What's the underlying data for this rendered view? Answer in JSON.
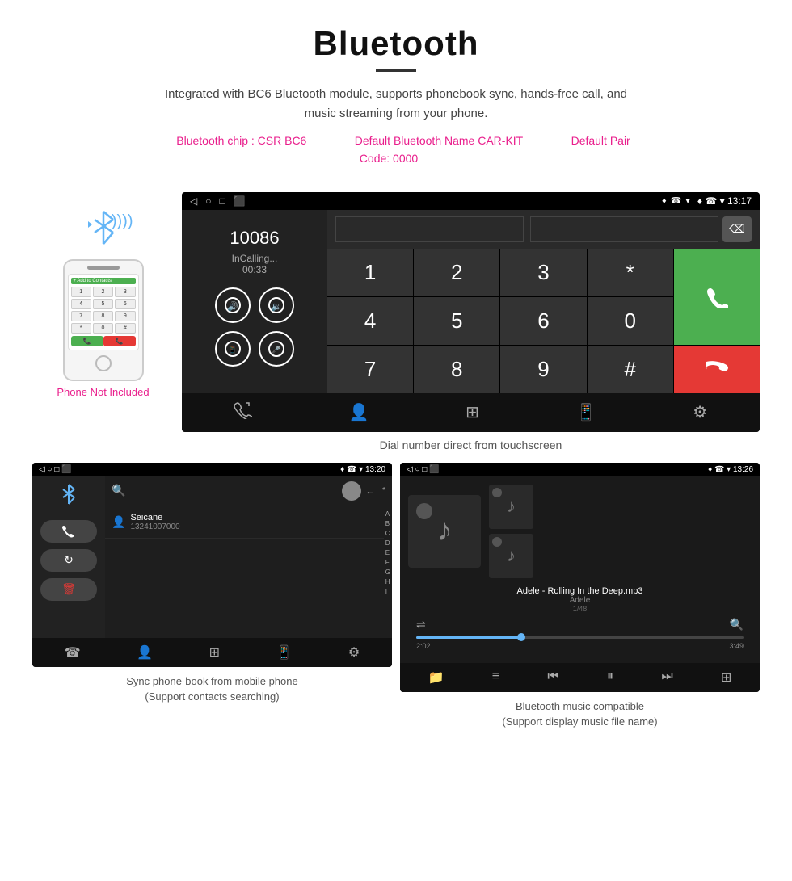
{
  "header": {
    "title": "Bluetooth",
    "description": "Integrated with BC6 Bluetooth module, supports phonebook sync, hands-free call, and music streaming from your phone.",
    "spec_chip": "Bluetooth chip : CSR BC6",
    "spec_name": "Default Bluetooth Name CAR-KIT",
    "spec_code": "Default Pair Code: 0000"
  },
  "phone_illustration": {
    "not_included": "Phone Not Included",
    "add_contacts": "+ Add to Contacts",
    "keys": [
      "1",
      "2",
      "3",
      "4",
      "5",
      "6",
      "7",
      "8",
      "9",
      "*",
      "0",
      "#"
    ],
    "call_green": "📞",
    "call_red": "📞"
  },
  "main_screen": {
    "status_bar": {
      "nav_icons": [
        "◁",
        "○",
        "□",
        "⬛"
      ],
      "right": "♦ ☎ ▾ 13:17"
    },
    "dial_number": "10086",
    "status": "InCalling...",
    "timer": "00:33",
    "numpad": [
      "1",
      "2",
      "3",
      "*",
      "4",
      "5",
      "6",
      "0",
      "7",
      "8",
      "9",
      "#"
    ],
    "bottom_icons": [
      "☎↑",
      "👤",
      "⊞",
      "📱",
      "⚙"
    ]
  },
  "main_caption": "Dial number direct from touchscreen",
  "phonebook_screen": {
    "status_bar": {
      "left": "◁ ○ □ ⬛",
      "right": "♦ ☎ ▾ 13:20"
    },
    "bt_icon": "✱",
    "contact_name": "Seicane",
    "contact_number": "13241007000",
    "alpha_list": [
      "A",
      "B",
      "C",
      "D",
      "E",
      "F",
      "G",
      "H",
      "I"
    ],
    "bottom_icons": [
      "☎↑",
      "👤",
      "⊞",
      "📱",
      "⚙"
    ]
  },
  "phonebook_caption": {
    "line1": "Sync phone-book from mobile phone",
    "line2": "(Support contacts searching)"
  },
  "music_screen": {
    "status_bar": {
      "left": "◁ ○ □ ⬛",
      "right": "♦ ☎ ▾ 13:26"
    },
    "track_name": "Adele - Rolling In the Deep.mp3",
    "artist": "Adele",
    "track_num": "1/48",
    "time_current": "2:02",
    "time_total": "3:49",
    "progress_pct": 32,
    "bottom_icons": [
      "📁",
      "≡",
      "⏮",
      "⏸",
      "⏭",
      "⊞⊞"
    ]
  },
  "music_caption": {
    "line1": "Bluetooth music compatible",
    "line2": "(Support display music file name)"
  }
}
